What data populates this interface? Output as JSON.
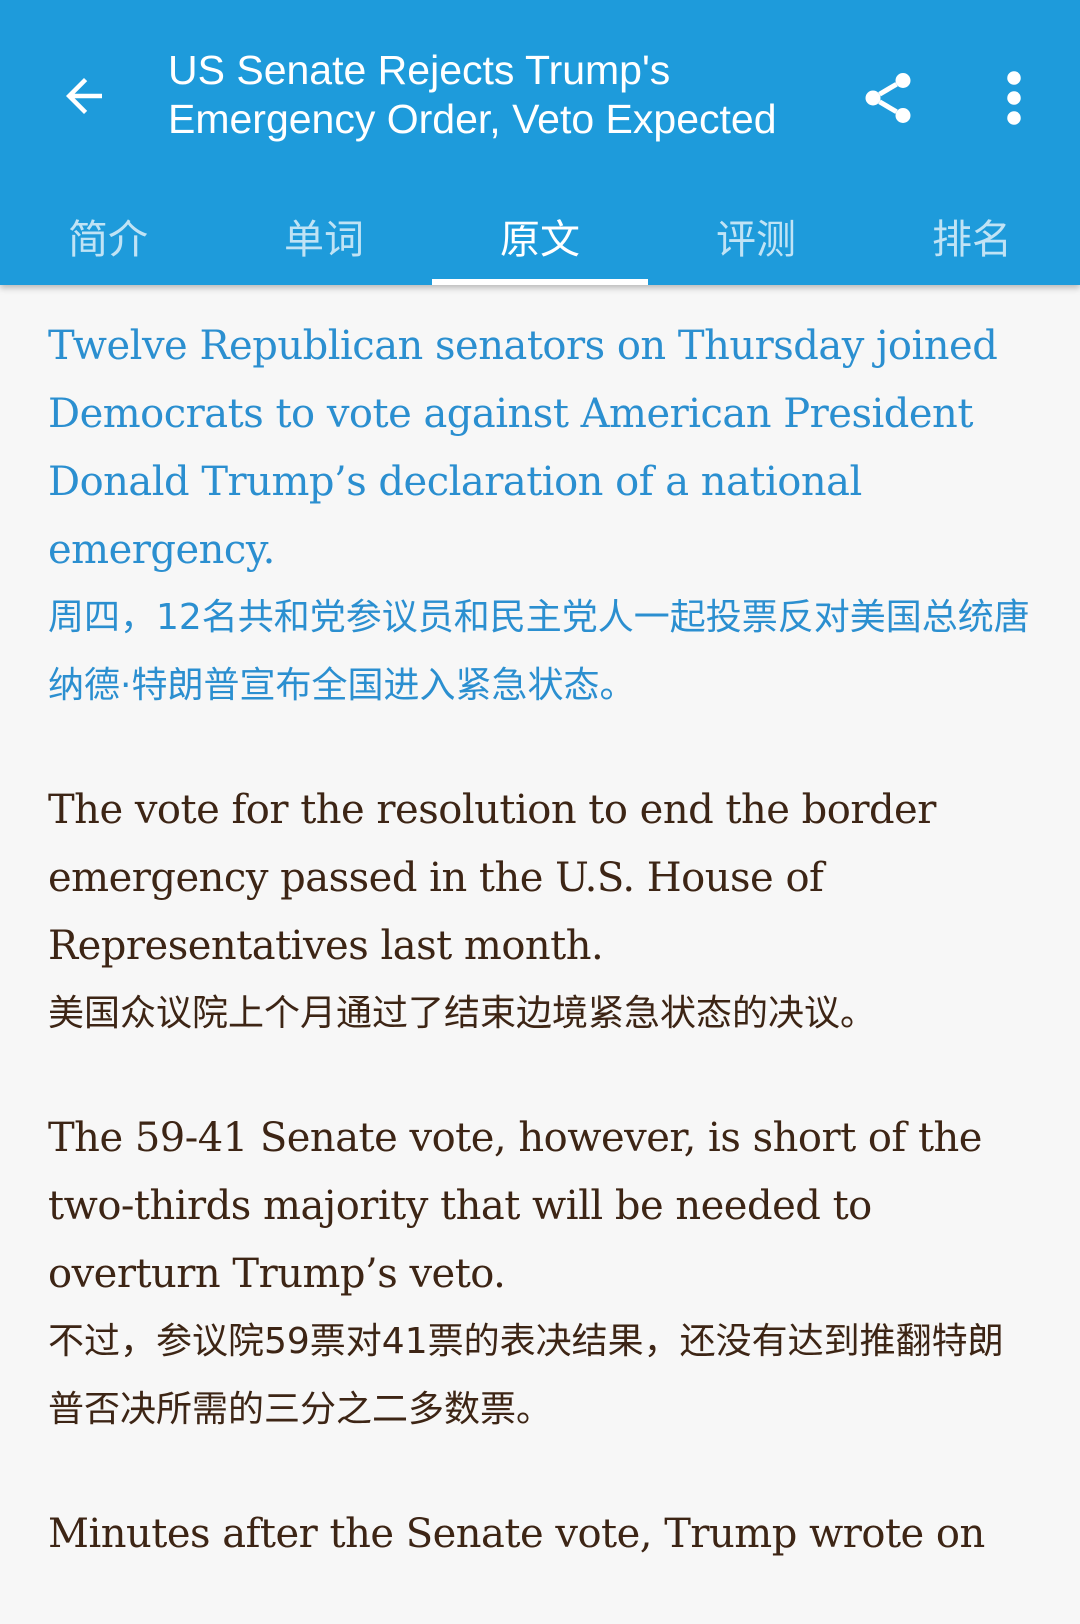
{
  "header": {
    "title": "US Senate Rejects Trump's Emergency Order, Veto Expected",
    "back_icon": "arrow-left-icon",
    "share_icon": "share-icon",
    "more_icon": "more-vert-icon",
    "background_color": "#1e9bdb"
  },
  "tabs": [
    {
      "label": "简介"
    },
    {
      "label": "单词"
    },
    {
      "label": "原文",
      "active": true
    },
    {
      "label": "评测"
    },
    {
      "label": "排名"
    }
  ],
  "paragraphs": [
    {
      "en": "Twelve Republican senators on Thursday joined Democrats to vote against American President Donald Trump’s declaration of a national emergency.",
      "zh": "周四，12名共和党参议员和民主党人一起投票反对美国总统唐纳德·特朗普宣布全国进入紧急状态。",
      "highlighted": true
    },
    {
      "en": "The vote for the resolution to end the border emergency passed in the U.S. House of Representatives last month.",
      "zh": "美国众议院上个月通过了结束边境紧急状态的决议。"
    },
    {
      "en": "The 59-41 Senate vote, however, is short of the two-thirds majority that will be needed to overturn Trump’s veto.",
      "zh": "不过，参议院59票对41票的表决结果，还没有达到推翻特朗普否决所需的三分之二多数票。"
    },
    {
      "en": "Minutes after the Senate vote, Trump wrote on",
      "zh": ""
    }
  ],
  "colors": {
    "highlight_text": "#2b8fd0",
    "body_text": "#3d2515",
    "page_background": "#f7f7f7"
  }
}
